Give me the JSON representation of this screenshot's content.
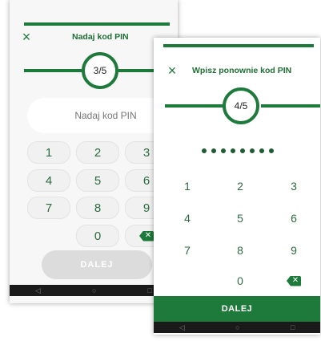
{
  "back_screen": {
    "close_icon": "×",
    "title": "Nadaj kod PIN",
    "step": "3/5",
    "pin_placeholder": "Nadaj kod PIN",
    "keys": [
      "1",
      "2",
      "3",
      "4",
      "5",
      "6",
      "7",
      "8",
      "9",
      "0"
    ],
    "backspace_icon": "backspace-icon",
    "next_label": "DALEJ",
    "nav": [
      "◁",
      "○",
      "□"
    ]
  },
  "front_screen": {
    "close_icon": "×",
    "title": "Wpisz ponownie kod PIN",
    "step": "4/5",
    "keys": [
      "1",
      "2",
      "3",
      "4",
      "5",
      "6",
      "7",
      "8",
      "9",
      "0"
    ],
    "backspace_icon": "backspace-icon",
    "next_label": "DALEJ",
    "nav": [
      "◁",
      "○",
      "□"
    ]
  },
  "colors": {
    "brand_green": "#1e7a3a",
    "nav_black": "#1a1a1a"
  }
}
